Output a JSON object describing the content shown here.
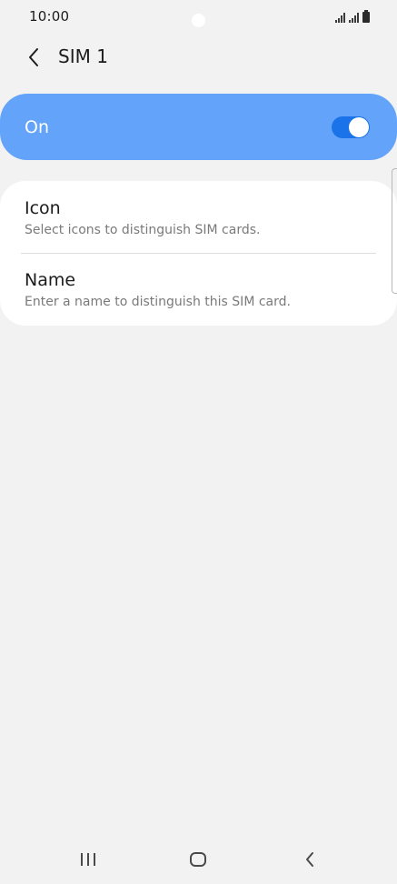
{
  "status_bar": {
    "time": "10:00"
  },
  "header": {
    "title": "SIM 1",
    "back_icon": "chevron-left-icon"
  },
  "master_switch": {
    "label": "On",
    "state": "on",
    "accent_color": "#63a4fa",
    "toggle_color": "#1a73e8"
  },
  "settings": {
    "items": [
      {
        "title": "Icon",
        "subtitle": "Select icons to distinguish SIM cards."
      },
      {
        "title": "Name",
        "subtitle": "Enter a name to distinguish this SIM card."
      }
    ]
  },
  "nav_bar": {
    "recents_icon": "recents-icon",
    "home_icon": "home-icon",
    "back_icon": "back-icon"
  }
}
